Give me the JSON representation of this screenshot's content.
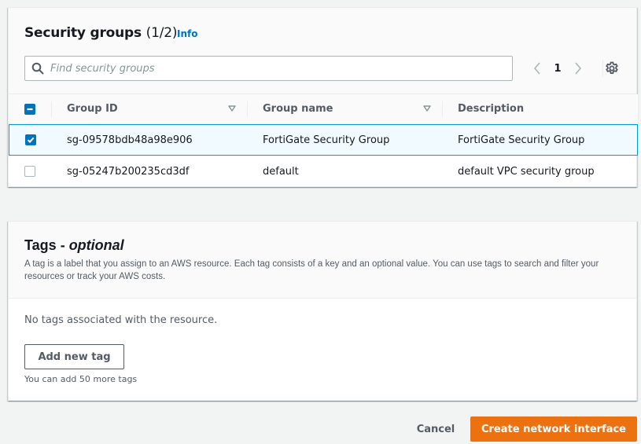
{
  "security_groups": {
    "title": "Security groups",
    "count": "(1/2)",
    "info_label": "Info",
    "search": {
      "placeholder": "Find security groups",
      "value": "",
      "icon": "search-icon"
    },
    "pagination": {
      "current_page": "1",
      "prev_icon": "chevron-left-icon",
      "next_icon": "chevron-right-icon"
    },
    "settings_icon": "gear-icon",
    "table": {
      "select_all_state": "indeterminate",
      "columns": [
        {
          "label": "Group ID",
          "sortable": true
        },
        {
          "label": "Group name",
          "sortable": true
        },
        {
          "label": "Description",
          "sortable": false
        }
      ],
      "rows": [
        {
          "selected": true,
          "group_id": "sg-09578bdb48a98e906",
          "group_name": "FortiGate Security Group",
          "description": "FortiGate Security Group"
        },
        {
          "selected": false,
          "group_id": "sg-05247b200235cd3df",
          "group_name": "default",
          "description": "default VPC security group"
        }
      ]
    }
  },
  "tags": {
    "title": "Tags",
    "title_separator": " - ",
    "title_optional": "optional",
    "description": "A tag is a label that you assign to an AWS resource. Each tag consists of a key and an optional value. You can use tags to search and filter your resources or track your AWS costs.",
    "empty_message": "No tags associated with the resource.",
    "add_button_label": "Add new tag",
    "limit_message": "You can add 50 more tags"
  },
  "footer": {
    "cancel_label": "Cancel",
    "create_label": "Create network interface"
  },
  "colors": {
    "primary_button": "#ec7211",
    "link": "#0073bb",
    "selected_row_bg": "#f1faff",
    "selected_row_border": "#00a1c9",
    "checkbox_checked": "#0073bb"
  }
}
